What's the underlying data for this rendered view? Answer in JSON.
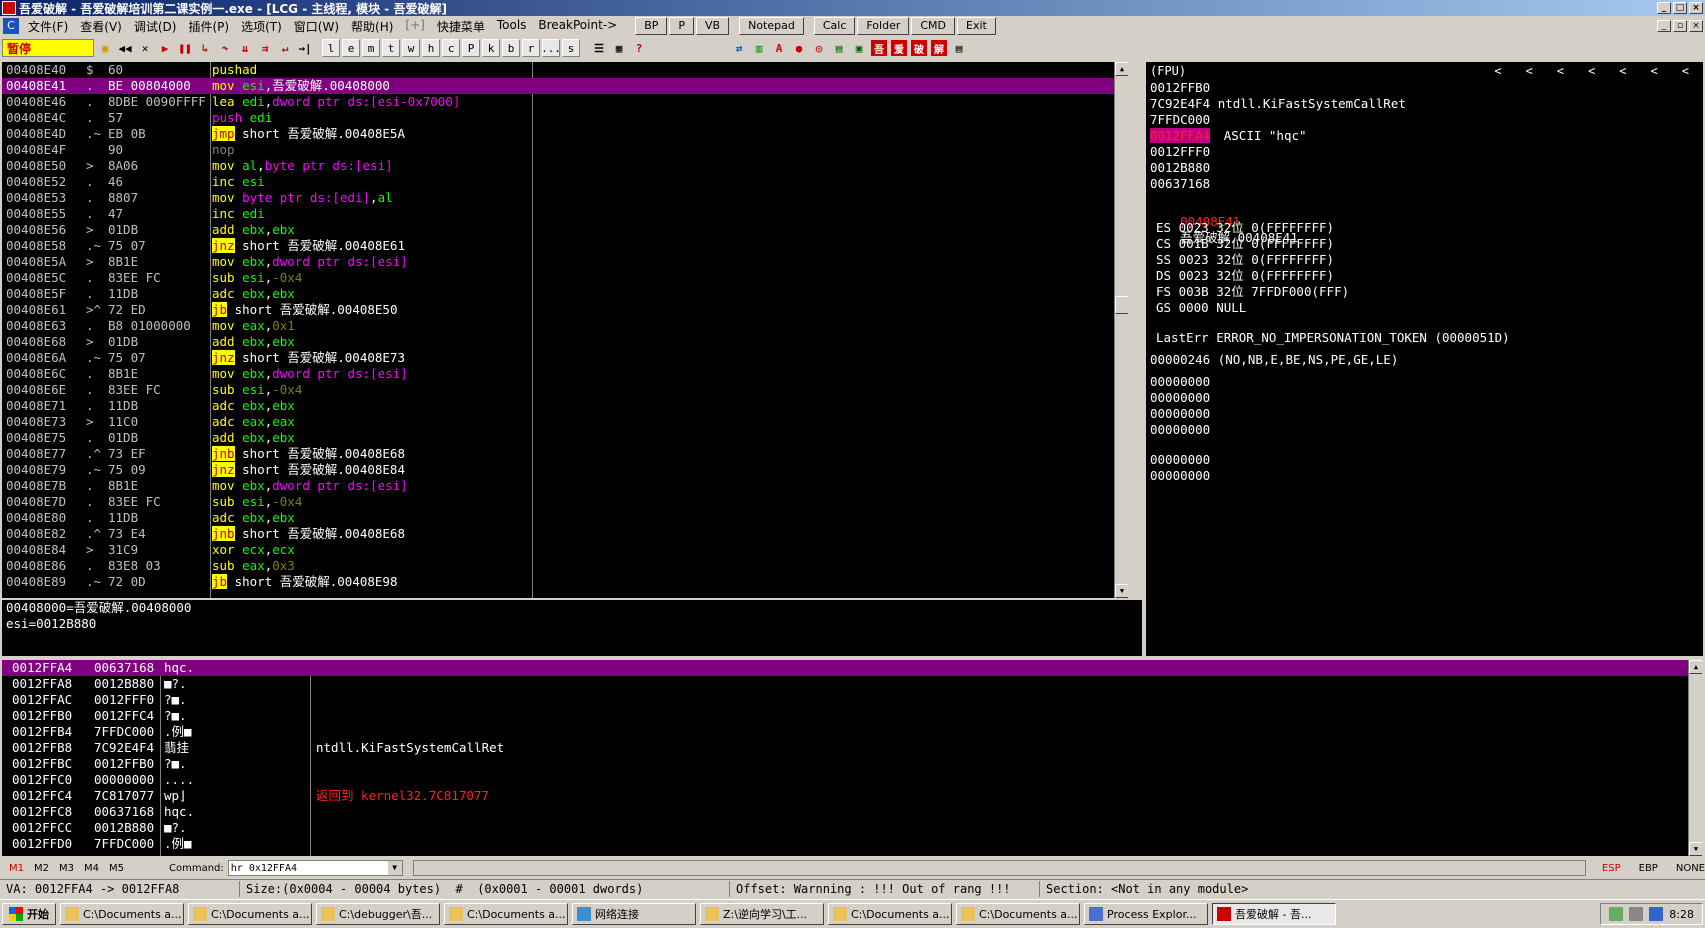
{
  "window": {
    "title": "吾爱破解 - 吾爱破解培训第二课实例一.exe - [LCG - 主线程, 模块 - 吾爱破解]"
  },
  "menu": {
    "items": [
      "文件(F)",
      "查看(V)",
      "调试(D)",
      "插件(P)",
      "选项(T)",
      "窗口(W)",
      "帮助(H)",
      "[+]",
      "快捷菜单",
      "Tools",
      "BreakPoint->"
    ],
    "buttons": [
      "BP",
      "P",
      "VB",
      "Notepad",
      "Calc",
      "Folder",
      "CMD",
      "Exit"
    ]
  },
  "toolbar": {
    "status": "暂停",
    "letters": [
      "l",
      "e",
      "m",
      "t",
      "w",
      "h",
      "c",
      "P",
      "k",
      "b",
      "r",
      "...",
      "s"
    ],
    "tail_icons": [
      "吾",
      "爱",
      "破",
      "解"
    ]
  },
  "cpu": {
    "rows": [
      {
        "addr": "00408E40",
        "mark": "$",
        "hex": "60",
        "parts": [
          {
            "t": "pushad",
            "c": "y"
          }
        ]
      },
      {
        "addr": "00408E41",
        "mark": ".",
        "hex": "BE 00804000",
        "hl": true,
        "parts": [
          {
            "t": "mov ",
            "c": "y"
          },
          {
            "t": "esi",
            "c": "r"
          },
          {
            "t": ",吾爱破解.00408000",
            "c": "w"
          }
        ]
      },
      {
        "addr": "00408E46",
        "mark": ".",
        "hex": "8DBE 0090FFFF",
        "parts": [
          {
            "t": "lea ",
            "c": "y"
          },
          {
            "t": "edi",
            "c": "r"
          },
          {
            "t": ",",
            "c": "w"
          },
          {
            "t": "dword ptr ds:[esi-0x7000]",
            "c": "m"
          }
        ]
      },
      {
        "addr": "00408E4C",
        "mark": ".",
        "hex": "57",
        "parts": [
          {
            "t": "push ",
            "c": "blue"
          },
          {
            "t": "edi",
            "c": "r"
          }
        ]
      },
      {
        "addr": "00408E4D",
        "mark": ".~",
        "hex": "EB 0B",
        "parts": [
          {
            "t": "jmp",
            "c": "jmp"
          },
          {
            "t": " short 吾爱破解.00408E5A",
            "c": "w"
          }
        ]
      },
      {
        "addr": "00408E4F",
        "mark": "",
        "hex": "90",
        "parts": [
          {
            "t": "nop",
            "c": "gr"
          }
        ]
      },
      {
        "addr": "00408E50",
        "mark": ">",
        "hex": "8A06",
        "parts": [
          {
            "t": "mov ",
            "c": "y"
          },
          {
            "t": "al",
            "c": "r"
          },
          {
            "t": ",",
            "c": "w"
          },
          {
            "t": "byte ptr ds:[esi]",
            "c": "m"
          }
        ]
      },
      {
        "addr": "00408E52",
        "mark": ".",
        "hex": "46",
        "parts": [
          {
            "t": "inc ",
            "c": "y"
          },
          {
            "t": "esi",
            "c": "r"
          }
        ]
      },
      {
        "addr": "00408E53",
        "mark": ".",
        "hex": "8807",
        "parts": [
          {
            "t": "mov ",
            "c": "y"
          },
          {
            "t": "byte ptr ds:[edi]",
            "c": "m"
          },
          {
            "t": ",",
            "c": "w"
          },
          {
            "t": "al",
            "c": "r"
          }
        ]
      },
      {
        "addr": "00408E55",
        "mark": ".",
        "hex": "47",
        "parts": [
          {
            "t": "inc ",
            "c": "y"
          },
          {
            "t": "edi",
            "c": "r"
          }
        ]
      },
      {
        "addr": "00408E56",
        "mark": ">",
        "hex": "01DB",
        "parts": [
          {
            "t": "add ",
            "c": "y"
          },
          {
            "t": "ebx",
            "c": "r"
          },
          {
            "t": ",",
            "c": "w"
          },
          {
            "t": "ebx",
            "c": "r"
          }
        ]
      },
      {
        "addr": "00408E58",
        "mark": ".~",
        "hex": "75 07",
        "parts": [
          {
            "t": "jnz",
            "c": "jmp"
          },
          {
            "t": " short 吾爱破解.00408E61",
            "c": "w"
          }
        ]
      },
      {
        "addr": "00408E5A",
        "mark": ">",
        "hex": "8B1E",
        "parts": [
          {
            "t": "mov ",
            "c": "y"
          },
          {
            "t": "ebx",
            "c": "r"
          },
          {
            "t": ",",
            "c": "w"
          },
          {
            "t": "dword ptr ds:[esi]",
            "c": "m"
          }
        ]
      },
      {
        "addr": "00408E5C",
        "mark": ".",
        "hex": "83EE FC",
        "parts": [
          {
            "t": "sub ",
            "c": "y"
          },
          {
            "t": "esi",
            "c": "r"
          },
          {
            "t": ",",
            "c": "w"
          },
          {
            "t": "-0x4",
            "c": "c"
          }
        ]
      },
      {
        "addr": "00408E5F",
        "mark": ".",
        "hex": "11DB",
        "parts": [
          {
            "t": "adc ",
            "c": "y"
          },
          {
            "t": "ebx",
            "c": "r"
          },
          {
            "t": ",",
            "c": "w"
          },
          {
            "t": "ebx",
            "c": "r"
          }
        ]
      },
      {
        "addr": "00408E61",
        "mark": ">^",
        "hex": "72 ED",
        "parts": [
          {
            "t": "jb",
            "c": "jmp"
          },
          {
            "t": " short 吾爱破解.00408E50",
            "c": "w"
          }
        ]
      },
      {
        "addr": "00408E63",
        "mark": ".",
        "hex": "B8 01000000",
        "parts": [
          {
            "t": "mov ",
            "c": "y"
          },
          {
            "t": "eax",
            "c": "r"
          },
          {
            "t": ",",
            "c": "w"
          },
          {
            "t": "0x1",
            "c": "c"
          }
        ]
      },
      {
        "addr": "00408E68",
        "mark": ">",
        "hex": "01DB",
        "parts": [
          {
            "t": "add ",
            "c": "y"
          },
          {
            "t": "ebx",
            "c": "r"
          },
          {
            "t": ",",
            "c": "w"
          },
          {
            "t": "ebx",
            "c": "r"
          }
        ]
      },
      {
        "addr": "00408E6A",
        "mark": ".~",
        "hex": "75 07",
        "parts": [
          {
            "t": "jnz",
            "c": "jmp"
          },
          {
            "t": " short 吾爱破解.00408E73",
            "c": "w"
          }
        ]
      },
      {
        "addr": "00408E6C",
        "mark": ".",
        "hex": "8B1E",
        "parts": [
          {
            "t": "mov ",
            "c": "y"
          },
          {
            "t": "ebx",
            "c": "r"
          },
          {
            "t": ",",
            "c": "w"
          },
          {
            "t": "dword ptr ds:[esi]",
            "c": "m"
          }
        ]
      },
      {
        "addr": "00408E6E",
        "mark": ".",
        "hex": "83EE FC",
        "parts": [
          {
            "t": "sub ",
            "c": "y"
          },
          {
            "t": "esi",
            "c": "r"
          },
          {
            "t": ",",
            "c": "w"
          },
          {
            "t": "-0x4",
            "c": "c"
          }
        ]
      },
      {
        "addr": "00408E71",
        "mark": ".",
        "hex": "11DB",
        "parts": [
          {
            "t": "adc ",
            "c": "y"
          },
          {
            "t": "ebx",
            "c": "r"
          },
          {
            "t": ",",
            "c": "w"
          },
          {
            "t": "ebx",
            "c": "r"
          }
        ]
      },
      {
        "addr": "00408E73",
        "mark": ">",
        "hex": "11C0",
        "parts": [
          {
            "t": "adc ",
            "c": "y"
          },
          {
            "t": "eax",
            "c": "r"
          },
          {
            "t": ",",
            "c": "w"
          },
          {
            "t": "eax",
            "c": "r"
          }
        ]
      },
      {
        "addr": "00408E75",
        "mark": ".",
        "hex": "01DB",
        "parts": [
          {
            "t": "add ",
            "c": "y"
          },
          {
            "t": "ebx",
            "c": "r"
          },
          {
            "t": ",",
            "c": "w"
          },
          {
            "t": "ebx",
            "c": "r"
          }
        ]
      },
      {
        "addr": "00408E77",
        "mark": ".^",
        "hex": "73 EF",
        "parts": [
          {
            "t": "jnb",
            "c": "jmp"
          },
          {
            "t": " short 吾爱破解.00408E68",
            "c": "w"
          }
        ]
      },
      {
        "addr": "00408E79",
        "mark": ".~",
        "hex": "75 09",
        "parts": [
          {
            "t": "jnz",
            "c": "jmp"
          },
          {
            "t": " short 吾爱破解.00408E84",
            "c": "w"
          }
        ]
      },
      {
        "addr": "00408E7B",
        "mark": ".",
        "hex": "8B1E",
        "parts": [
          {
            "t": "mov ",
            "c": "y"
          },
          {
            "t": "ebx",
            "c": "r"
          },
          {
            "t": ",",
            "c": "w"
          },
          {
            "t": "dword ptr ds:[esi]",
            "c": "m"
          }
        ]
      },
      {
        "addr": "00408E7D",
        "mark": ".",
        "hex": "83EE FC",
        "parts": [
          {
            "t": "sub ",
            "c": "y"
          },
          {
            "t": "esi",
            "c": "r"
          },
          {
            "t": ",",
            "c": "w"
          },
          {
            "t": "-0x4",
            "c": "c"
          }
        ]
      },
      {
        "addr": "00408E80",
        "mark": ".",
        "hex": "11DB",
        "parts": [
          {
            "t": "adc ",
            "c": "y"
          },
          {
            "t": "ebx",
            "c": "r"
          },
          {
            "t": ",",
            "c": "w"
          },
          {
            "t": "ebx",
            "c": "r"
          }
        ]
      },
      {
        "addr": "00408E82",
        "mark": ".^",
        "hex": "73 E4",
        "parts": [
          {
            "t": "jnb",
            "c": "jmp"
          },
          {
            "t": " short 吾爱破解.00408E68",
            "c": "w"
          }
        ]
      },
      {
        "addr": "00408E84",
        "mark": ">",
        "hex": "31C9",
        "parts": [
          {
            "t": "xor ",
            "c": "y"
          },
          {
            "t": "ecx",
            "c": "r"
          },
          {
            "t": ",",
            "c": "w"
          },
          {
            "t": "ecx",
            "c": "r"
          }
        ]
      },
      {
        "addr": "00408E86",
        "mark": ".",
        "hex": "83E8 03",
        "parts": [
          {
            "t": "sub ",
            "c": "y"
          },
          {
            "t": "eax",
            "c": "r"
          },
          {
            "t": ",",
            "c": "w"
          },
          {
            "t": "0x3",
            "c": "c"
          }
        ]
      },
      {
        "addr": "00408E89",
        "mark": ".~",
        "hex": "72 0D",
        "parts": [
          {
            "t": "jb",
            "c": "jmp"
          },
          {
            "t": " short 吾爱破解.00408E98",
            "c": "w"
          }
        ]
      }
    ]
  },
  "info": {
    "lines": [
      "00408000=吾爱破解.00408000",
      "esi=0012B880"
    ]
  },
  "registers": {
    "header": "(FPU)",
    "stack_lines": [
      {
        "t": "0012FFB0"
      },
      {
        "t": "7C92E4F4 ntdll.KiFastSystemCallRet"
      },
      {
        "t": "7FFDC000"
      },
      {
        "t": "0012FFA4",
        "comment": "ASCII \"hqc\"",
        "badge": true
      },
      {
        "t": "0012FFF0"
      },
      {
        "t": "0012B880"
      },
      {
        "t": "00637168"
      }
    ],
    "eip": {
      "addr": "00408E41",
      "label": "吾爱破解.00408E41"
    },
    "segments": [
      "ES 0023 32位 0(FFFFFFFF)",
      "CS 001B 32位 0(FFFFFFFF)",
      "SS 0023 32位 0(FFFFFFFF)",
      "DS 0023 32位 0(FFFFFFFF)",
      "FS 003B 32位 7FFDF000(FFF)",
      "GS 0000 NULL"
    ],
    "lasterr": "LastErr ERROR_NO_IMPERSONATION_TOKEN (0000051D)",
    "flags": "00000246 (NO,NB,E,BE,NS,PE,GE,LE)",
    "zeros1": [
      "00000000",
      "00000000",
      "00000000",
      "00000000"
    ],
    "zeros2": [
      "00000000",
      "00000000"
    ]
  },
  "stack": {
    "rows": [
      {
        "a": "0012FFA4",
        "v": "00637168",
        "t": "hqc.",
        "c": "",
        "hl": true
      },
      {
        "a": "0012FFA8",
        "v": "0012B880",
        "t": "■?.",
        "c": ""
      },
      {
        "a": "0012FFAC",
        "v": "0012FFF0",
        "t": "?■.",
        "c": ""
      },
      {
        "a": "0012FFB0",
        "v": "0012FFC4",
        "t": "?■.",
        "c": ""
      },
      {
        "a": "0012FFB4",
        "v": "7FFDC000",
        "t": ".例■",
        "c": ""
      },
      {
        "a": "0012FFB8",
        "v": "7C92E4F4",
        "t": "翡挂",
        "c": "ntdll.KiFastSystemCallRet"
      },
      {
        "a": "0012FFBC",
        "v": "0012FFB0",
        "t": "?■.",
        "c": ""
      },
      {
        "a": "0012FFC0",
        "v": "00000000",
        "t": "....",
        "c": ""
      },
      {
        "a": "0012FFC4",
        "v": "7C817077",
        "t": "wp⌋",
        "c": "返回到 kernel32.7C817077",
        "red": true
      },
      {
        "a": "0012FFC8",
        "v": "00637168",
        "t": "hqc.",
        "c": ""
      },
      {
        "a": "0012FFCC",
        "v": "0012B880",
        "t": "■?.",
        "c": ""
      },
      {
        "a": "0012FFD0",
        "v": "7FFDC000",
        "t": ".例■",
        "c": ""
      }
    ]
  },
  "command": {
    "marks": [
      "M1",
      "M2",
      "M3",
      "M4",
      "M5"
    ],
    "label": "Command:",
    "value": "hr 0x12FFA4",
    "regs": [
      "ESP",
      "EBP",
      "NONE"
    ]
  },
  "status": {
    "segments": [
      "VA: 0012FFA4 -> 0012FFA8",
      "Size:(0x0004 - 00004 bytes)  #  (0x0001 - 00001 dwords)",
      "Offset: Warnning : !!! Out of rang !!!",
      "Section: <Not in any module>"
    ]
  },
  "taskbar": {
    "start": "开始",
    "tasks": [
      "C:\\Documents a...",
      "C:\\Documents a...",
      "C:\\debugger\\吾...",
      "C:\\Documents a...",
      "网络连接",
      "Z:\\逆向学习\\工...",
      "C:\\Documents a...",
      "C:\\Documents a...",
      "Process Explor...",
      "吾爱破解 - 吾..."
    ],
    "clock": "8:28"
  },
  "colors": {
    "highlight": "#800080",
    "jump": "#ffff00",
    "reg": "#00ff00",
    "mem": "#ff00ff"
  }
}
